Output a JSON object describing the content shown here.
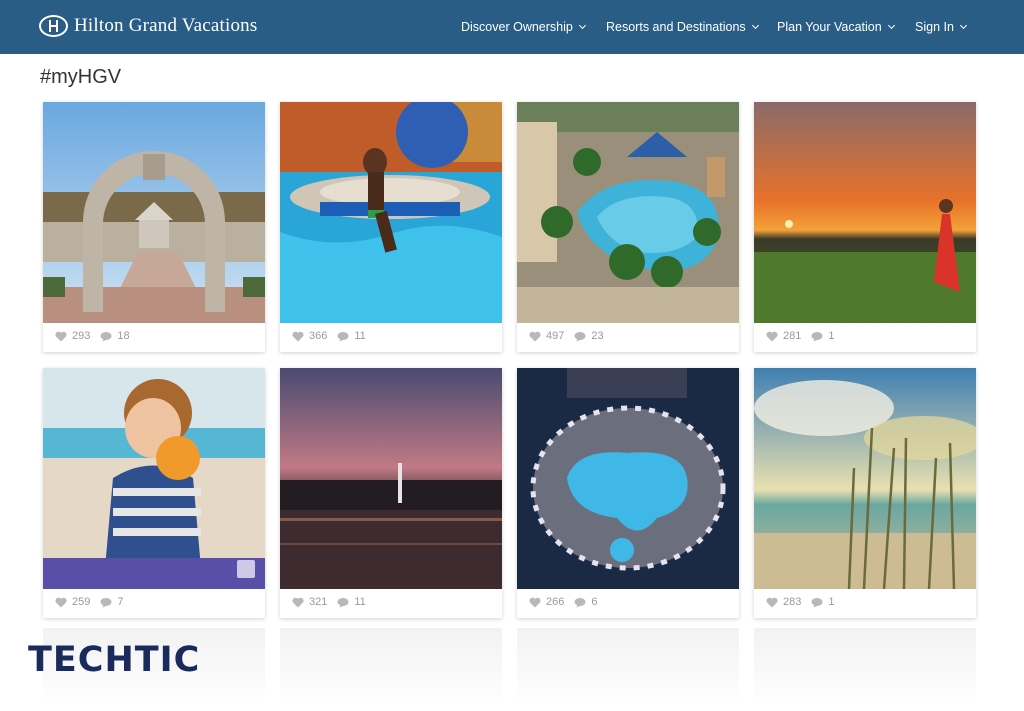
{
  "brand": {
    "name": "Hilton Grand Vacations"
  },
  "nav": [
    {
      "label": "Discover Ownership"
    },
    {
      "label": "Resorts and Destinations"
    },
    {
      "label": "Plan Your Vacation"
    },
    {
      "label": "Sign In"
    }
  ],
  "page": {
    "title": "#myHGV"
  },
  "posts": [
    {
      "likes": "293",
      "comments": "18"
    },
    {
      "likes": "366",
      "comments": "11"
    },
    {
      "likes": "497",
      "comments": "23"
    },
    {
      "likes": "281",
      "comments": "1"
    },
    {
      "likes": "259",
      "comments": "7"
    },
    {
      "likes": "321",
      "comments": "11"
    },
    {
      "likes": "266",
      "comments": "6"
    },
    {
      "likes": "283",
      "comments": "1"
    }
  ],
  "watermark": "TECHTIC",
  "colors": {
    "header": "#2a5d86",
    "watermark": "#1b2a5c"
  }
}
